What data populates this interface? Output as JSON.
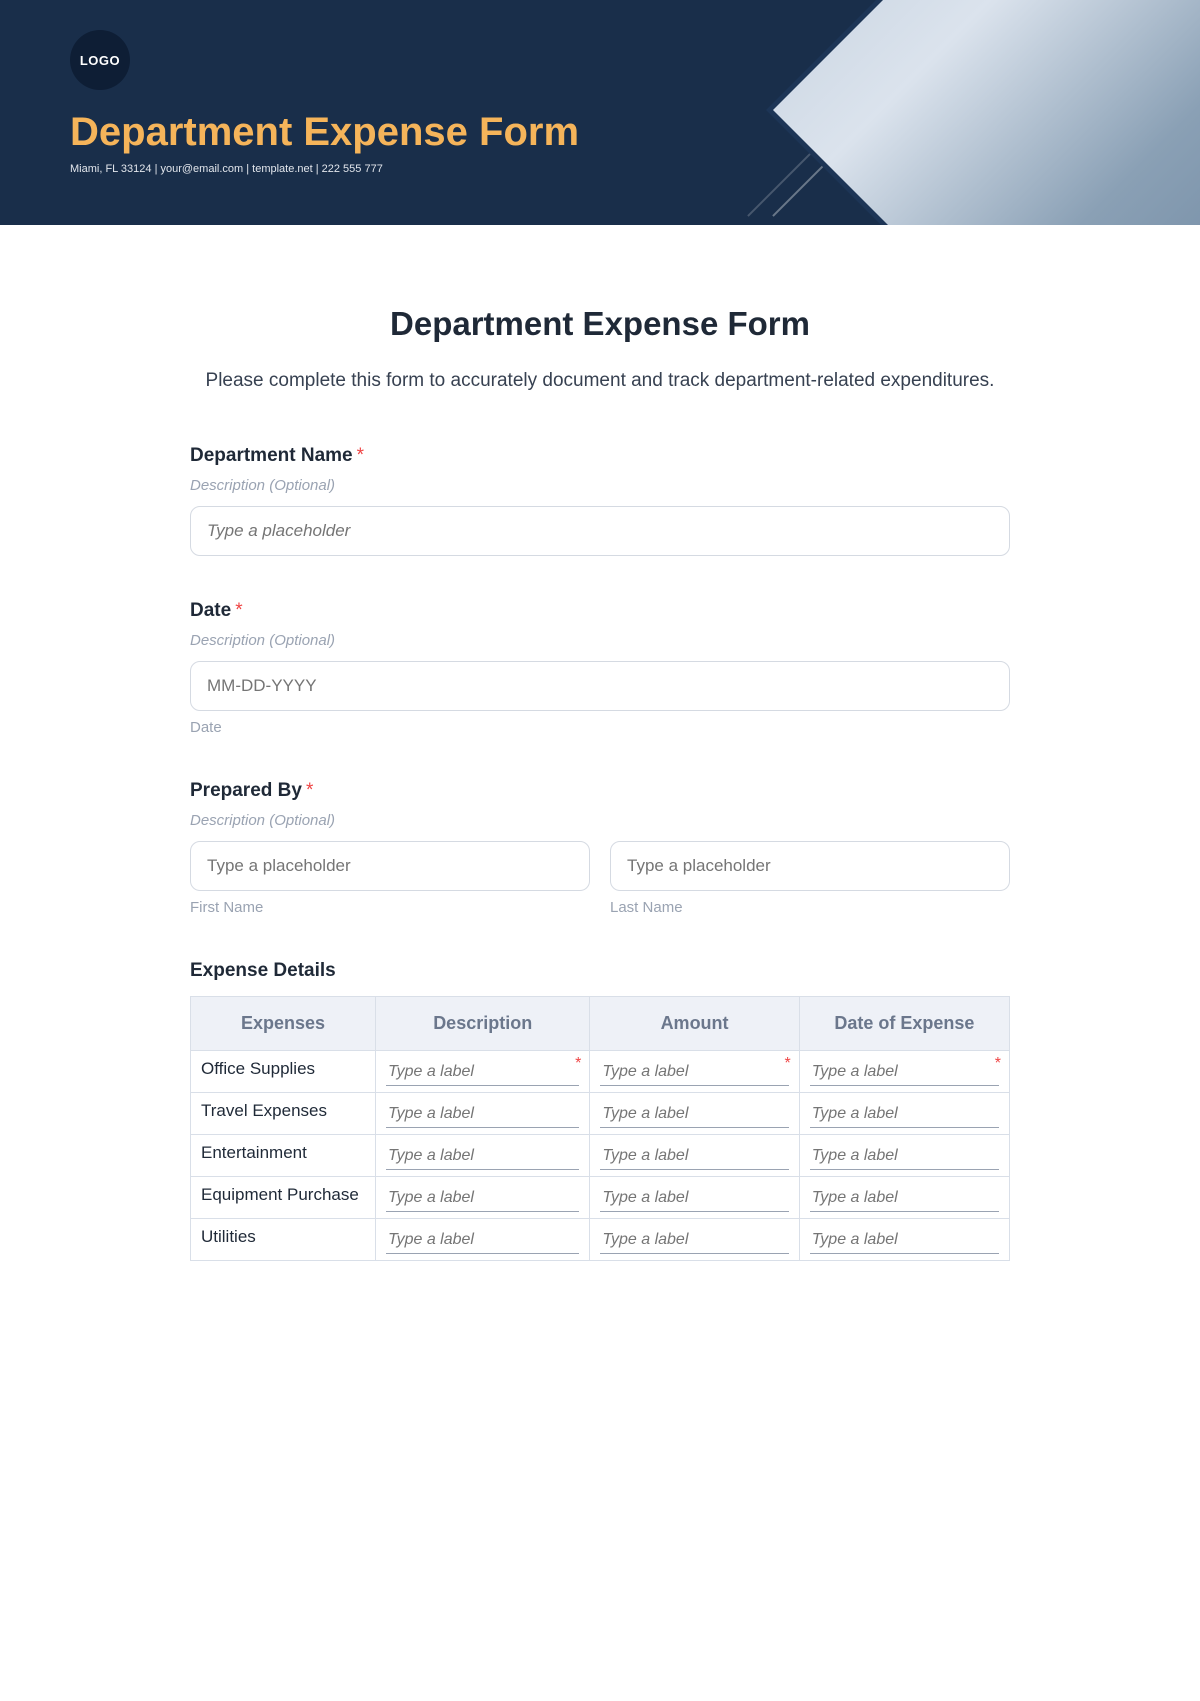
{
  "hero": {
    "logo_text": "LOGO",
    "title": "Department Expense Form",
    "subtitle": "Miami, FL 33124 | your@email.com | template.net | 222 555 777"
  },
  "form": {
    "title": "Department Expense Form",
    "intro": "Please complete this form to accurately document and track department-related expenditures."
  },
  "fields": {
    "department": {
      "label": "Department Name",
      "description": "Description (Optional)",
      "placeholder": "Type a placeholder"
    },
    "date": {
      "label": "Date",
      "description": "Description (Optional)",
      "placeholder": "MM-DD-YYYY",
      "sublabel": "Date"
    },
    "prepared": {
      "label": "Prepared By",
      "description": "Description (Optional)",
      "first_placeholder": "Type a placeholder",
      "last_placeholder": "Type a placeholder",
      "first_sublabel": "First Name",
      "last_sublabel": "Last Name"
    }
  },
  "expense_section": {
    "title": "Expense Details"
  },
  "table": {
    "headers": {
      "c1": "Expenses",
      "c2": "Description",
      "c3": "Amount",
      "c4": "Date of Expense"
    },
    "cell_placeholder": "Type a label",
    "rows": [
      {
        "name": "Office Supplies",
        "required": true
      },
      {
        "name": "Travel Expenses",
        "required": false
      },
      {
        "name": "Entertainment",
        "required": false
      },
      {
        "name": "Equipment Purchase",
        "required": false
      },
      {
        "name": "Utilities",
        "required": false
      }
    ]
  },
  "required_mark": "*"
}
